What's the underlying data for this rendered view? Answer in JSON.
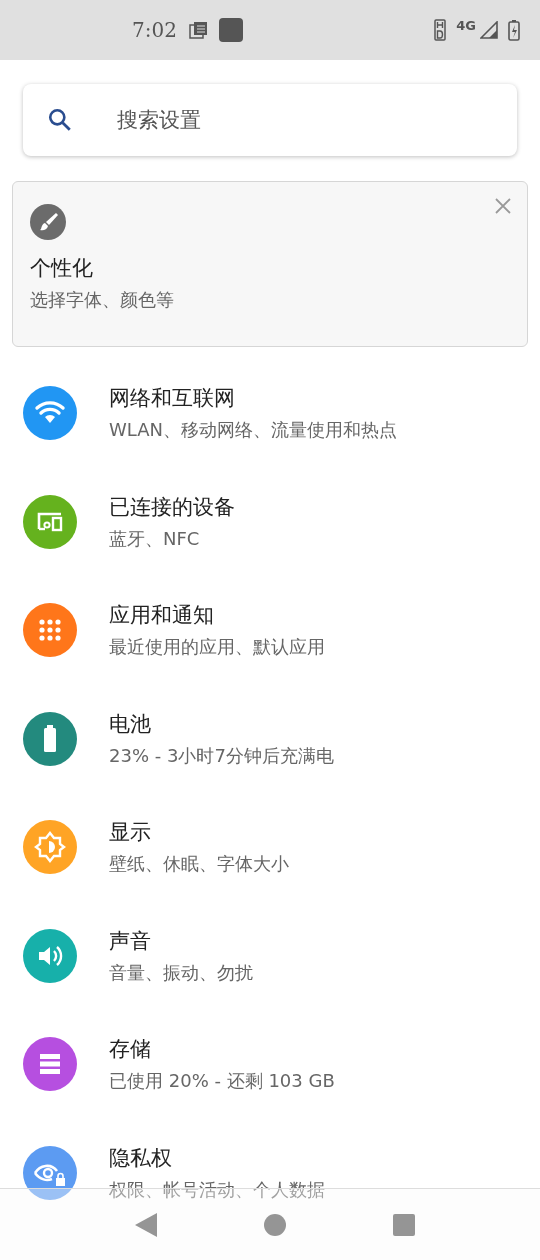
{
  "status_bar": {
    "time": "7:02",
    "network": "4G"
  },
  "search": {
    "placeholder": "搜索设置"
  },
  "suggestion": {
    "title": "个性化",
    "subtitle": "选择字体、颜色等"
  },
  "items": [
    {
      "kind": "wifi",
      "color": "#2196f3",
      "title": "网络和互联网",
      "subtitle": "WLAN、移动网络、流量使用和热点"
    },
    {
      "kind": "devices",
      "color": "#65b21e",
      "title": "已连接的设备",
      "subtitle": "蓝牙、NFC"
    },
    {
      "kind": "apps",
      "color": "#ff761a",
      "title": "应用和通知",
      "subtitle": "最近使用的应用、默认应用"
    },
    {
      "kind": "battery",
      "color": "#238a7e",
      "title": "电池",
      "subtitle": "23% - 3小时7分钟后充满电"
    },
    {
      "kind": "display",
      "color": "#ffa425",
      "title": "显示",
      "subtitle": "壁纸、休眠、字体大小"
    },
    {
      "kind": "sound",
      "color": "#17b0aa",
      "title": "声音",
      "subtitle": "音量、振动、勿扰"
    },
    {
      "kind": "storage",
      "color": "#b64fe0",
      "title": "存储",
      "subtitle": "已使用 20% - 还剩 103 GB"
    },
    {
      "kind": "privacy",
      "color": "#5c9bf2",
      "title": "隐私权",
      "subtitle": "权限、帐号活动、个人数据"
    }
  ]
}
